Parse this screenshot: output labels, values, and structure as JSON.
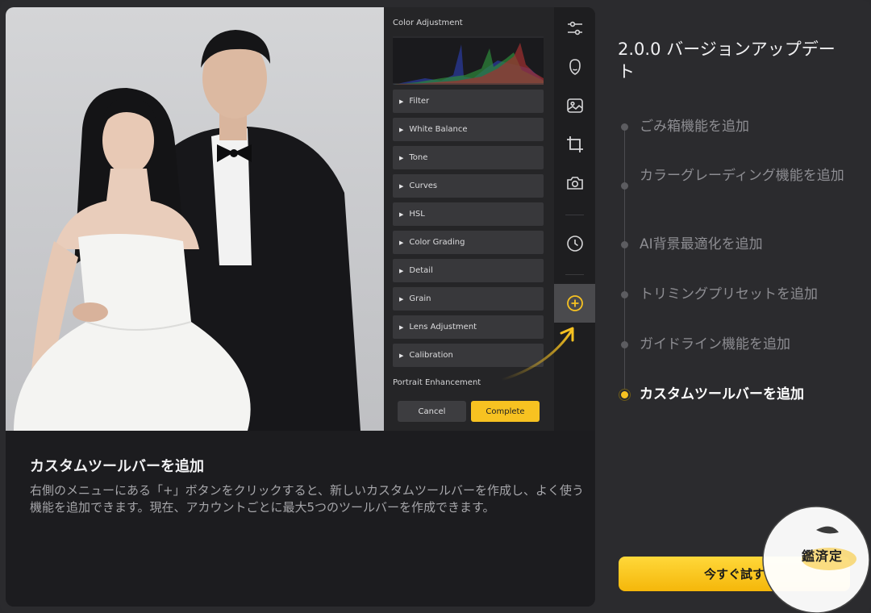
{
  "editor": {
    "panel_title": "Color Adjustment",
    "sections": [
      "Filter",
      "White Balance",
      "Tone",
      "Curves",
      "HSL",
      "Color Grading",
      "Detail",
      "Grain",
      "Lens Adjustment",
      "Calibration"
    ],
    "portrait_label": "Portrait Enhancement",
    "cancel_label": "Cancel",
    "complete_label": "Complete",
    "tools": [
      "sliders-icon",
      "face-icon",
      "image-icon",
      "crop-icon",
      "camera-icon",
      "history-icon",
      "add-circle-icon"
    ]
  },
  "caption": {
    "title": "カスタムツールバーを追加",
    "body": "右側のメニューにある「+」ボタンをクリックすると、新しいカスタムツールバーを作成し、よく使う機能を追加できます。現在、アカウントごとに最大5つのツールバーを作成できます。"
  },
  "update": {
    "title": "2.0.0 バージョンアップデート",
    "items": [
      "ごみ箱機能を追加",
      "カラーグレーディング機能を追加",
      "AI背景最適化を追加",
      "トリミングプリセットを追加",
      "ガイドライン機能を追加",
      "カスタムツールバーを追加"
    ],
    "current_index": 5,
    "try_label": "今すぐ試す"
  },
  "watermark": {
    "text": "鑑済定"
  },
  "colors": {
    "accent": "#f7c221",
    "background": "#2b2b2e",
    "card": "#1c1c1f"
  }
}
